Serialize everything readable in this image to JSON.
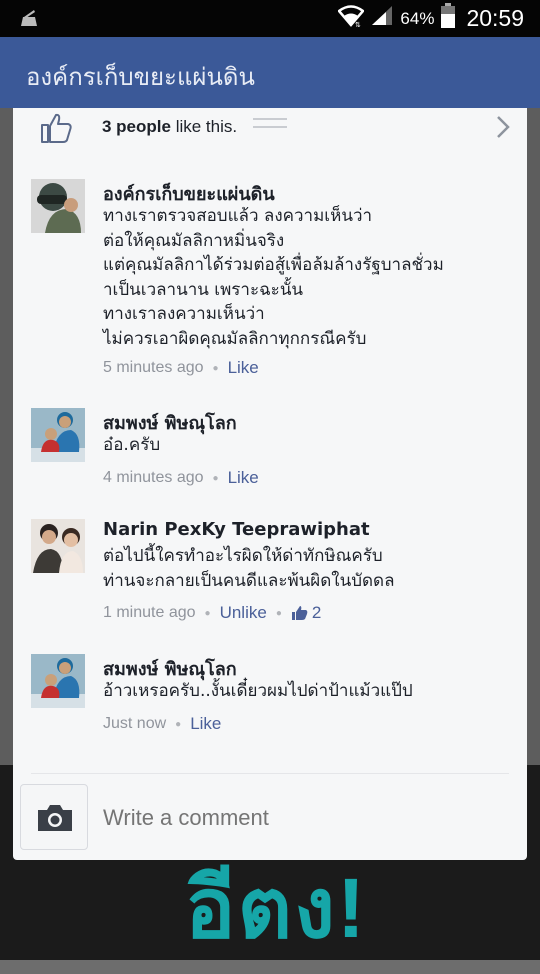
{
  "status_bar": {
    "battery_percent": "64%",
    "time": "20:59",
    "icons": [
      "android-debug-icon",
      "wifi-icon",
      "signal-icon",
      "battery-icon"
    ]
  },
  "app_bar": {
    "title": "องค์กรเก็บขยะแผ่นดิน"
  },
  "likes_row": {
    "count_text": "3 people",
    "suffix": " like this."
  },
  "comments": [
    {
      "author": "องค์กรเก็บขยะแผ่นดิน",
      "text": "ทางเราตรวจสอบแล้ว ลงความเห็นว่า\nต่อให้คุณมัลลิกาหมิ่นจริง\nแต่คุณมัลลิกาได้ร่วมต่อสู้เพื่อล้มล้างรัฐบาลชั่วม\nาเป็นเวลานาน เพราะฉะนั้น\nทางเราลงความเห็นว่า\nไม่ควรเอาผิดคุณมัลลิกาทุกกรณีครับ",
      "time": "5 minutes ago",
      "action": "Like"
    },
    {
      "author": "สมพงษ์ พิษณุโลก",
      "text": "อ๋อ.ครับ",
      "time": "4 minutes ago",
      "action": "Like"
    },
    {
      "author": "Narin PexKy Teeprawiphat",
      "text": "ต่อไปนี้ใครทำอะไรผิดให้ด่าทักษิณครับ\nท่านจะกลายเป็นคนดีและพ้นผิดในบัดดล",
      "time": "1 minute ago",
      "action": "Unlike",
      "likes": "2"
    },
    {
      "author": "สมพงษ์ พิษณุโลก",
      "text": "อ้าวเหรอครับ..งั้นเดี๋ยวผมไปด่าป้าแม้วแป๊ป",
      "time": "Just now",
      "action": "Like"
    }
  ],
  "composer": {
    "placeholder": "Write a comment"
  },
  "background": {
    "big_text": "อีตง!"
  },
  "colors": {
    "header": "#3b5998",
    "link": "#4b6099",
    "meta": "#90949c",
    "accent_teal": "#16a6a8"
  }
}
